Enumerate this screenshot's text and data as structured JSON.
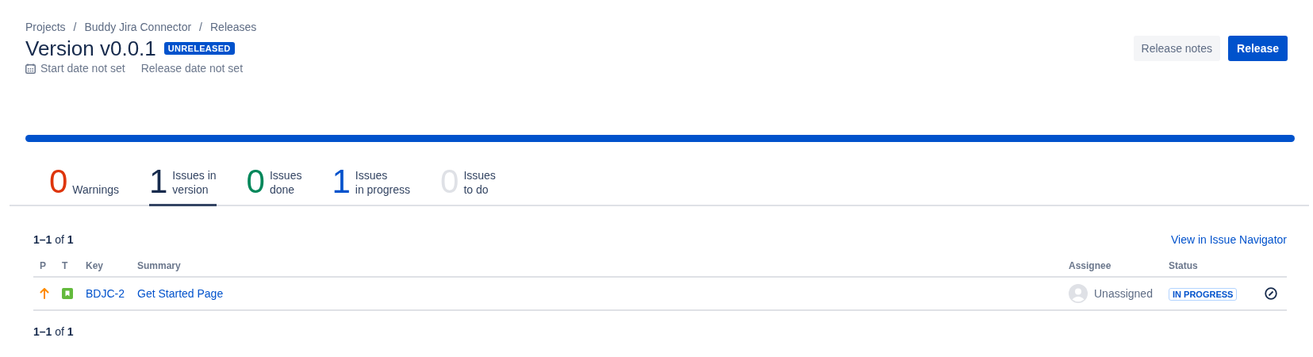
{
  "breadcrumbs": [
    "Projects",
    "Buddy Jira Connector",
    "Releases"
  ],
  "breadcrumb_separators": [
    "/",
    "/"
  ],
  "header": {
    "title": "Version v0.0.1",
    "badge": "UNRELEASED",
    "start_date": "Start date not set",
    "release_date": "Release date not set"
  },
  "actions": [
    {
      "label": "Release notes",
      "kind": "secondary"
    },
    {
      "label": "Release",
      "kind": "primary"
    }
  ],
  "progress_bar": {
    "level": 1
  },
  "tabs": [
    {
      "count": "0",
      "label": [
        "Warnings"
      ],
      "color": "#de350b",
      "selected": false
    },
    {
      "count": "1",
      "label": [
        "Issues in",
        "version"
      ],
      "color": "#172b4d",
      "selected": true
    },
    {
      "count": "0",
      "label": [
        "Issues",
        "done"
      ],
      "color": "#00875a",
      "selected": false
    },
    {
      "count": "1",
      "label": [
        "Issues",
        "in progress"
      ],
      "color": "#0052cc",
      "selected": false
    },
    {
      "count": "0",
      "label": [
        "Issues",
        "to do"
      ],
      "color": "#dfe1e6",
      "selected": false
    }
  ],
  "pager_top": "**1–1** of **1**",
  "navigator_link": "View in Issue Navigator",
  "table": {
    "columns": [
      "P",
      "T",
      "Key",
      "Summary",
      "Assignee",
      "Status"
    ],
    "rows": [
      {
        "key": "BDJC-2",
        "summary": "Get Started Page",
        "assignee": "Unassigned",
        "status": "IN PROGRESS"
      }
    ]
  },
  "pager_bottom": "**1–1** of **1**"
}
